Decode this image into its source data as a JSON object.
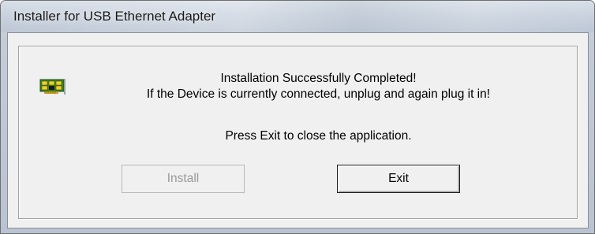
{
  "window": {
    "title": "Installer for USB Ethernet Adapter"
  },
  "message": {
    "line1": "Installation Successfully Completed!",
    "line2": "If the Device is currently connected, unplug and again plug it in!",
    "line3": "Press Exit to close the application."
  },
  "buttons": {
    "install_label": "Install",
    "install_enabled": false,
    "exit_label": "Exit"
  },
  "icons": {
    "device": "network-card-icon"
  }
}
